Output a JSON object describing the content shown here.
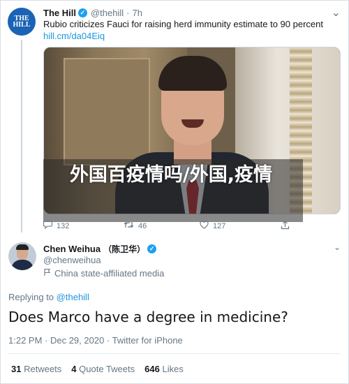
{
  "parent": {
    "avatar_text": "THE HILL",
    "name": "The Hill",
    "handle": "@thehill",
    "time": "7h",
    "text": "Rubio criticizes Fauci for raising herd immunity estimate to 90 percent",
    "link": "hill.cm/da04Eiq",
    "overlay_caption": "外国百疫情吗/外国,疫情",
    "actions": {
      "replies": "132",
      "retweets": "46",
      "likes": "127"
    }
  },
  "main": {
    "name": "Chen Weihua",
    "name_cn": "（陈卫华）",
    "handle": "@chenweihua",
    "affiliation": "China state-affiliated media",
    "replying_prefix": "Replying to",
    "replying_handle": "@thehill",
    "text": "Does Marco have a degree in medicine?",
    "meta": "1:22 PM · Dec 29, 2020 · Twitter for iPhone",
    "stats": {
      "retweets_count": "31",
      "retweets_label": "Retweets",
      "quotes_count": "4",
      "quotes_label": "Quote Tweets",
      "likes_count": "646",
      "likes_label": "Likes"
    }
  },
  "icons": {
    "verified": "check-icon",
    "reply": "speech-bubble-icon",
    "retweet": "retweet-icon",
    "like": "heart-icon",
    "share": "share-icon",
    "affiliation": "flag-icon",
    "chevron": "chevron-down-icon"
  },
  "colors": {
    "accent": "#1da1f2",
    "link": "#1b95e0",
    "muted": "#657786",
    "hill_brand": "#1b63b5"
  }
}
